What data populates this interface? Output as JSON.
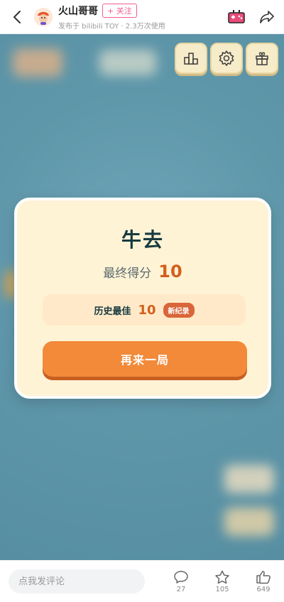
{
  "header": {
    "author": "火山哥哥",
    "follow_label": "+ 关注",
    "subtitle": "发布于 bilibili TOY · 2.3万次使用"
  },
  "game": {
    "result": {
      "title": "牛去",
      "score_label": "最终得分",
      "score_value": "10",
      "best_label": "历史最佳",
      "best_value": "10",
      "new_record_badge": "新纪录",
      "play_again_label": "再来一局"
    },
    "icons": [
      "leaderboard-icon",
      "settings-gear-icon",
      "gift-icon"
    ]
  },
  "footer": {
    "comment_placeholder": "点我发评论",
    "actions": [
      {
        "icon": "comment-icon",
        "count": "27"
      },
      {
        "icon": "star-icon",
        "count": "105"
      },
      {
        "icon": "thumbs-up-icon",
        "count": "649"
      }
    ]
  },
  "colors": {
    "accent_pink": "#f25d8e",
    "score_orange": "#d45f1c",
    "button_orange": "#f28a3a",
    "card_bg": "#fff3d6",
    "game_bg": "#5f97aa"
  }
}
